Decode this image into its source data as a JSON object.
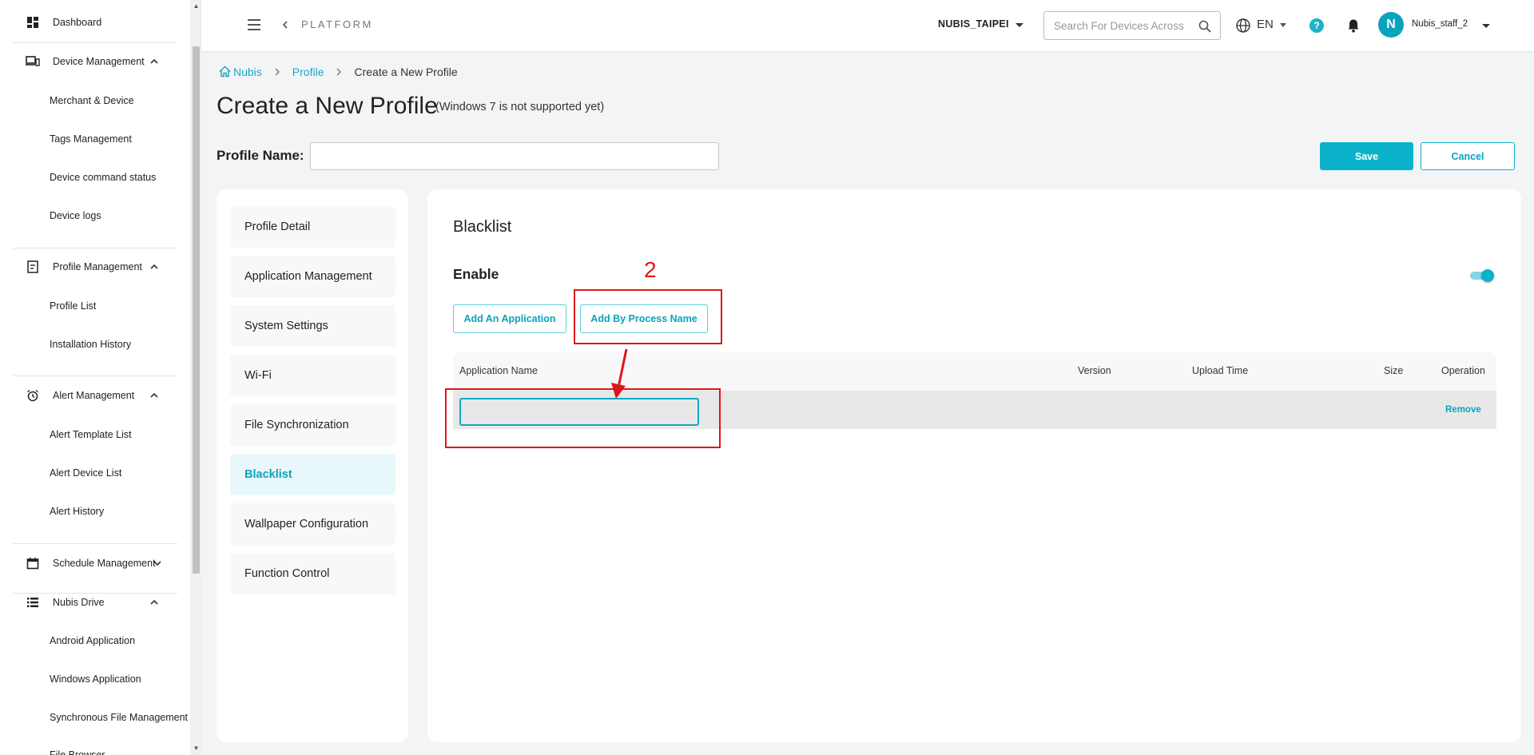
{
  "sidebar": {
    "dashboard": "Dashboard",
    "device_management": {
      "label": "Device Management",
      "items": [
        "Merchant & Device",
        "Tags Management",
        "Device command status",
        "Device logs"
      ]
    },
    "profile_management": {
      "label": "Profile Management",
      "items": [
        "Profile List",
        "Installation History"
      ]
    },
    "alert_management": {
      "label": "Alert Management",
      "items": [
        "Alert Template List",
        "Alert Device List",
        "Alert History"
      ]
    },
    "schedule_management": {
      "label": "Schedule Management"
    },
    "nubis_drive": {
      "label": "Nubis Drive",
      "items": [
        "Android Application",
        "Windows Application",
        "Synchronous File Management",
        "File Browser"
      ]
    }
  },
  "topbar": {
    "platform": "PLATFORM",
    "organization": "NUBIS_TAIPEI",
    "search_placeholder": "Search For Devices Across",
    "language": "EN",
    "help": "?",
    "avatar_initial": "N",
    "username": "Nubis_staff_2"
  },
  "breadcrumb": {
    "home": "Nubis",
    "section": "Profile",
    "current": "Create a New Profile"
  },
  "page": {
    "title": "Create a New Profile",
    "note": "(Windows 7 is not supported yet)",
    "profile_name_label": "Profile Name:",
    "profile_name_value": "",
    "save": "Save",
    "cancel": "Cancel"
  },
  "profile_menu": [
    {
      "label": "Profile Detail",
      "active": false
    },
    {
      "label": "Application Management",
      "active": false
    },
    {
      "label": "System Settings",
      "active": false
    },
    {
      "label": "Wi-Fi",
      "active": false
    },
    {
      "label": "File Synchronization",
      "active": false
    },
    {
      "label": "Blacklist",
      "active": true
    },
    {
      "label": "Wallpaper Configuration",
      "active": false
    },
    {
      "label": "Function Control",
      "active": false
    }
  ],
  "blacklist": {
    "title": "Blacklist",
    "enable_label": "Enable",
    "enabled": true,
    "add_application": "Add An Application",
    "add_by_process": "Add By Process Name",
    "columns": [
      "Application Name",
      "Version",
      "Upload Time",
      "Size",
      "Operation"
    ],
    "rows": [
      {
        "application_name": "",
        "operation": "Remove"
      }
    ]
  },
  "annotation": {
    "step_number": "2",
    "color": "#e0141b"
  },
  "colors": {
    "accent": "#0ab3c9",
    "link": "#1aa7c3"
  }
}
